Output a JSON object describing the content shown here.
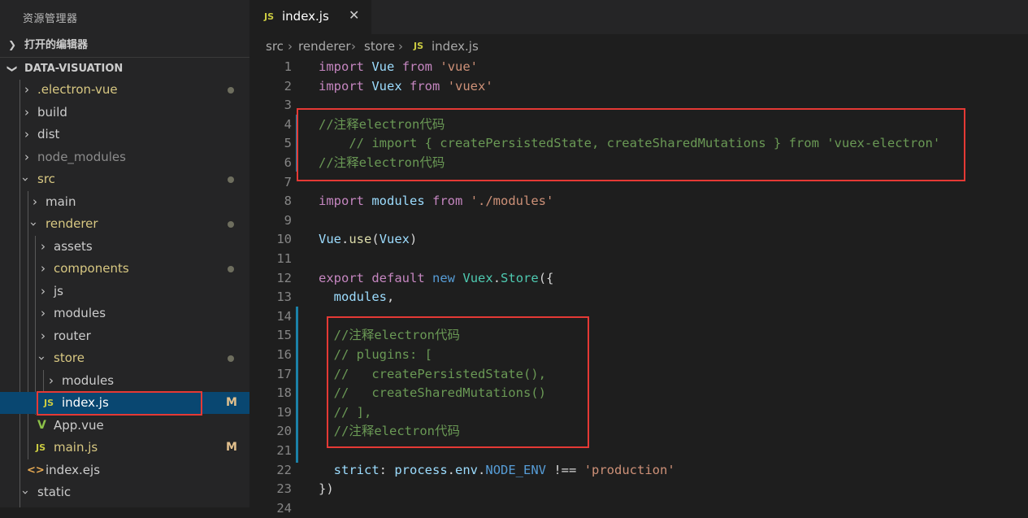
{
  "explorer": {
    "title": "资源管理器",
    "open_editors": "打开的编辑器",
    "project": "DATA-VISUATION",
    "items": [
      {
        "label": "electron-vue-prefix",
        "text": ".electron-vue"
      },
      {
        "text": "build"
      },
      {
        "text": "dist"
      },
      {
        "text": "node_modules"
      },
      {
        "text": "src"
      },
      {
        "text": "main"
      },
      {
        "text": "renderer"
      },
      {
        "text": "assets"
      },
      {
        "text": "components"
      },
      {
        "text": "js"
      },
      {
        "text": "modules"
      },
      {
        "text": "router"
      },
      {
        "text": "store"
      },
      {
        "text": "modules"
      },
      {
        "text": "index.js",
        "badge": "M"
      },
      {
        "text": "App.vue"
      },
      {
        "text": "main.js",
        "badge": "M"
      },
      {
        "text": "index.ejs"
      },
      {
        "text": "static"
      }
    ]
  },
  "icons": {
    "js": "JS",
    "vue": "V",
    "ejs": "<>"
  },
  "tab": {
    "label": "index.js",
    "close": "✕"
  },
  "breadcrumb": {
    "parts": [
      "src",
      "renderer",
      "store",
      "index.js"
    ]
  },
  "code": {
    "lines": [
      {
        "n": "1",
        "tokens": [
          [
            "kw",
            "import"
          ],
          [
            "pl",
            " "
          ],
          [
            "id",
            "Vue"
          ],
          [
            "pl",
            " "
          ],
          [
            "kw",
            "from"
          ],
          [
            "pl",
            " "
          ],
          [
            "str",
            "'vue'"
          ]
        ]
      },
      {
        "n": "2",
        "tokens": [
          [
            "kw",
            "import"
          ],
          [
            "pl",
            " "
          ],
          [
            "id",
            "Vuex"
          ],
          [
            "pl",
            " "
          ],
          [
            "kw",
            "from"
          ],
          [
            "pl",
            " "
          ],
          [
            "str",
            "'vuex'"
          ]
        ]
      },
      {
        "n": "3",
        "tokens": []
      },
      {
        "n": "4",
        "tokens": [
          [
            "cm",
            "//注释electron代码"
          ]
        ]
      },
      {
        "n": "5",
        "tokens": [
          [
            "cm",
            "    // import { createPersistedState, createSharedMutations } from 'vuex-electron'"
          ]
        ]
      },
      {
        "n": "6",
        "tokens": [
          [
            "cm",
            "//注释electron代码"
          ]
        ]
      },
      {
        "n": "7",
        "tokens": []
      },
      {
        "n": "8",
        "tokens": [
          [
            "kw",
            "import"
          ],
          [
            "pl",
            " "
          ],
          [
            "id",
            "modules"
          ],
          [
            "pl",
            " "
          ],
          [
            "kw",
            "from"
          ],
          [
            "pl",
            " "
          ],
          [
            "str",
            "'./modules'"
          ]
        ]
      },
      {
        "n": "9",
        "tokens": []
      },
      {
        "n": "10",
        "tokens": [
          [
            "id",
            "Vue"
          ],
          [
            "pl",
            "."
          ],
          [
            "fn",
            "use"
          ],
          [
            "pl",
            "("
          ],
          [
            "id",
            "Vuex"
          ],
          [
            "pl",
            ")"
          ]
        ]
      },
      {
        "n": "11",
        "tokens": []
      },
      {
        "n": "12",
        "tokens": [
          [
            "kw",
            "export"
          ],
          [
            "pl",
            " "
          ],
          [
            "kw",
            "default"
          ],
          [
            "pl",
            " "
          ],
          [
            "ct",
            "new"
          ],
          [
            "pl",
            " "
          ],
          [
            "cls",
            "Vuex"
          ],
          [
            "pl",
            "."
          ],
          [
            "cls",
            "Store"
          ],
          [
            "pl",
            "({"
          ]
        ]
      },
      {
        "n": "13",
        "tokens": [
          [
            "pl",
            "  "
          ],
          [
            "id",
            "modules"
          ],
          [
            "pl",
            ","
          ]
        ]
      },
      {
        "n": "14",
        "tokens": []
      },
      {
        "n": "15",
        "tokens": [
          [
            "cm",
            "  //注释electron代码"
          ]
        ]
      },
      {
        "n": "16",
        "tokens": [
          [
            "cm",
            "  // plugins: ["
          ]
        ]
      },
      {
        "n": "17",
        "tokens": [
          [
            "cm",
            "  //   createPersistedState(),"
          ]
        ]
      },
      {
        "n": "18",
        "tokens": [
          [
            "cm",
            "  //   createSharedMutations()"
          ]
        ]
      },
      {
        "n": "19",
        "tokens": [
          [
            "cm",
            "  // ],"
          ]
        ]
      },
      {
        "n": "20",
        "tokens": [
          [
            "cm",
            "  //注释electron代码"
          ]
        ]
      },
      {
        "n": "21",
        "tokens": []
      },
      {
        "n": "22",
        "tokens": [
          [
            "pl",
            "  "
          ],
          [
            "id",
            "strict"
          ],
          [
            "pl",
            ": "
          ],
          [
            "id",
            "process"
          ],
          [
            "pl",
            "."
          ],
          [
            "id",
            "env"
          ],
          [
            "pl",
            "."
          ],
          [
            "ct",
            "NODE_ENV"
          ],
          [
            "pl",
            " !== "
          ],
          [
            "str",
            "'production'"
          ]
        ]
      },
      {
        "n": "23",
        "tokens": [
          [
            "pl",
            "})"
          ]
        ]
      },
      {
        "n": "24",
        "tokens": []
      }
    ]
  }
}
